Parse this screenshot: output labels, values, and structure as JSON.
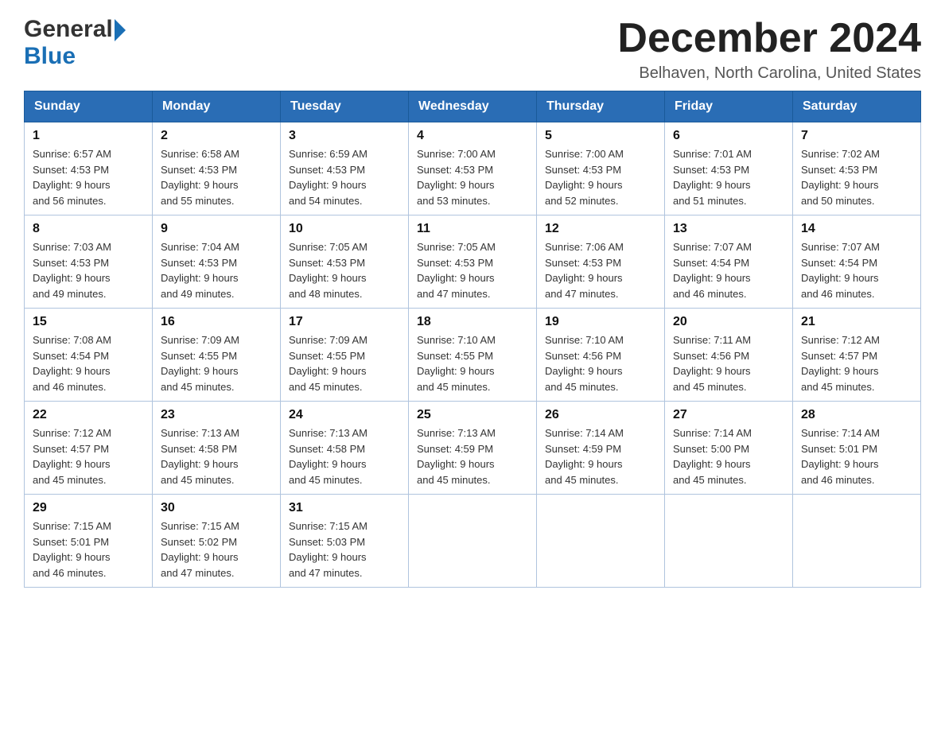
{
  "header": {
    "logo_general": "General",
    "logo_blue": "Blue",
    "month_title": "December 2024",
    "location": "Belhaven, North Carolina, United States"
  },
  "weekdays": [
    "Sunday",
    "Monday",
    "Tuesday",
    "Wednesday",
    "Thursday",
    "Friday",
    "Saturday"
  ],
  "weeks": [
    [
      {
        "day": "1",
        "sunrise": "6:57 AM",
        "sunset": "4:53 PM",
        "daylight": "9 hours and 56 minutes."
      },
      {
        "day": "2",
        "sunrise": "6:58 AM",
        "sunset": "4:53 PM",
        "daylight": "9 hours and 55 minutes."
      },
      {
        "day": "3",
        "sunrise": "6:59 AM",
        "sunset": "4:53 PM",
        "daylight": "9 hours and 54 minutes."
      },
      {
        "day": "4",
        "sunrise": "7:00 AM",
        "sunset": "4:53 PM",
        "daylight": "9 hours and 53 minutes."
      },
      {
        "day": "5",
        "sunrise": "7:00 AM",
        "sunset": "4:53 PM",
        "daylight": "9 hours and 52 minutes."
      },
      {
        "day": "6",
        "sunrise": "7:01 AM",
        "sunset": "4:53 PM",
        "daylight": "9 hours and 51 minutes."
      },
      {
        "day": "7",
        "sunrise": "7:02 AM",
        "sunset": "4:53 PM",
        "daylight": "9 hours and 50 minutes."
      }
    ],
    [
      {
        "day": "8",
        "sunrise": "7:03 AM",
        "sunset": "4:53 PM",
        "daylight": "9 hours and 49 minutes."
      },
      {
        "day": "9",
        "sunrise": "7:04 AM",
        "sunset": "4:53 PM",
        "daylight": "9 hours and 49 minutes."
      },
      {
        "day": "10",
        "sunrise": "7:05 AM",
        "sunset": "4:53 PM",
        "daylight": "9 hours and 48 minutes."
      },
      {
        "day": "11",
        "sunrise": "7:05 AM",
        "sunset": "4:53 PM",
        "daylight": "9 hours and 47 minutes."
      },
      {
        "day": "12",
        "sunrise": "7:06 AM",
        "sunset": "4:53 PM",
        "daylight": "9 hours and 47 minutes."
      },
      {
        "day": "13",
        "sunrise": "7:07 AM",
        "sunset": "4:54 PM",
        "daylight": "9 hours and 46 minutes."
      },
      {
        "day": "14",
        "sunrise": "7:07 AM",
        "sunset": "4:54 PM",
        "daylight": "9 hours and 46 minutes."
      }
    ],
    [
      {
        "day": "15",
        "sunrise": "7:08 AM",
        "sunset": "4:54 PM",
        "daylight": "9 hours and 46 minutes."
      },
      {
        "day": "16",
        "sunrise": "7:09 AM",
        "sunset": "4:55 PM",
        "daylight": "9 hours and 45 minutes."
      },
      {
        "day": "17",
        "sunrise": "7:09 AM",
        "sunset": "4:55 PM",
        "daylight": "9 hours and 45 minutes."
      },
      {
        "day": "18",
        "sunrise": "7:10 AM",
        "sunset": "4:55 PM",
        "daylight": "9 hours and 45 minutes."
      },
      {
        "day": "19",
        "sunrise": "7:10 AM",
        "sunset": "4:56 PM",
        "daylight": "9 hours and 45 minutes."
      },
      {
        "day": "20",
        "sunrise": "7:11 AM",
        "sunset": "4:56 PM",
        "daylight": "9 hours and 45 minutes."
      },
      {
        "day": "21",
        "sunrise": "7:12 AM",
        "sunset": "4:57 PM",
        "daylight": "9 hours and 45 minutes."
      }
    ],
    [
      {
        "day": "22",
        "sunrise": "7:12 AM",
        "sunset": "4:57 PM",
        "daylight": "9 hours and 45 minutes."
      },
      {
        "day": "23",
        "sunrise": "7:13 AM",
        "sunset": "4:58 PM",
        "daylight": "9 hours and 45 minutes."
      },
      {
        "day": "24",
        "sunrise": "7:13 AM",
        "sunset": "4:58 PM",
        "daylight": "9 hours and 45 minutes."
      },
      {
        "day": "25",
        "sunrise": "7:13 AM",
        "sunset": "4:59 PM",
        "daylight": "9 hours and 45 minutes."
      },
      {
        "day": "26",
        "sunrise": "7:14 AM",
        "sunset": "4:59 PM",
        "daylight": "9 hours and 45 minutes."
      },
      {
        "day": "27",
        "sunrise": "7:14 AM",
        "sunset": "5:00 PM",
        "daylight": "9 hours and 45 minutes."
      },
      {
        "day": "28",
        "sunrise": "7:14 AM",
        "sunset": "5:01 PM",
        "daylight": "9 hours and 46 minutes."
      }
    ],
    [
      {
        "day": "29",
        "sunrise": "7:15 AM",
        "sunset": "5:01 PM",
        "daylight": "9 hours and 46 minutes."
      },
      {
        "day": "30",
        "sunrise": "7:15 AM",
        "sunset": "5:02 PM",
        "daylight": "9 hours and 47 minutes."
      },
      {
        "day": "31",
        "sunrise": "7:15 AM",
        "sunset": "5:03 PM",
        "daylight": "9 hours and 47 minutes."
      },
      null,
      null,
      null,
      null
    ]
  ],
  "labels": {
    "sunrise": "Sunrise:",
    "sunset": "Sunset:",
    "daylight": "Daylight:"
  }
}
